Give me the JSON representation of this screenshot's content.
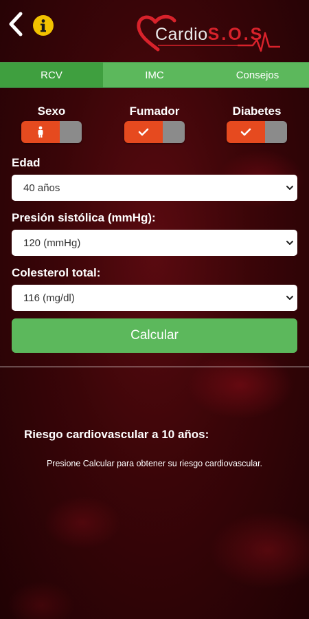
{
  "header": {
    "logo": {
      "prefix": "Cardio",
      "highlight": "S.O.S"
    }
  },
  "tabs": [
    {
      "label": "RCV",
      "active": true
    },
    {
      "label": "IMC",
      "active": false
    },
    {
      "label": "Consejos",
      "active": false
    }
  ],
  "toggles": {
    "sexo": {
      "label": "Sexo",
      "icon": "person-icon"
    },
    "fumador": {
      "label": "Fumador",
      "icon": "check-icon"
    },
    "diabetes": {
      "label": "Diabetes",
      "icon": "check-icon"
    }
  },
  "form": {
    "edad": {
      "label": "Edad",
      "value": "40 años"
    },
    "presion": {
      "label": "Presión sistólica (mmHg):",
      "value": "120 (mmHg)"
    },
    "colesterol": {
      "label": "Colesterol total:",
      "value": "116 (mg/dl)"
    },
    "calcular_label": "Calcular"
  },
  "result": {
    "title": "Riesgo cardiovascular a 10 años:",
    "message": "Presione Calcular para obtener su riesgo cardiovascular."
  },
  "colors": {
    "accent_green": "#5cb85c",
    "toggle_on": "#e64a1f",
    "toggle_off": "#8b8b8b",
    "info_yellow": "#f2c200",
    "brand_red": "#d8222b"
  }
}
